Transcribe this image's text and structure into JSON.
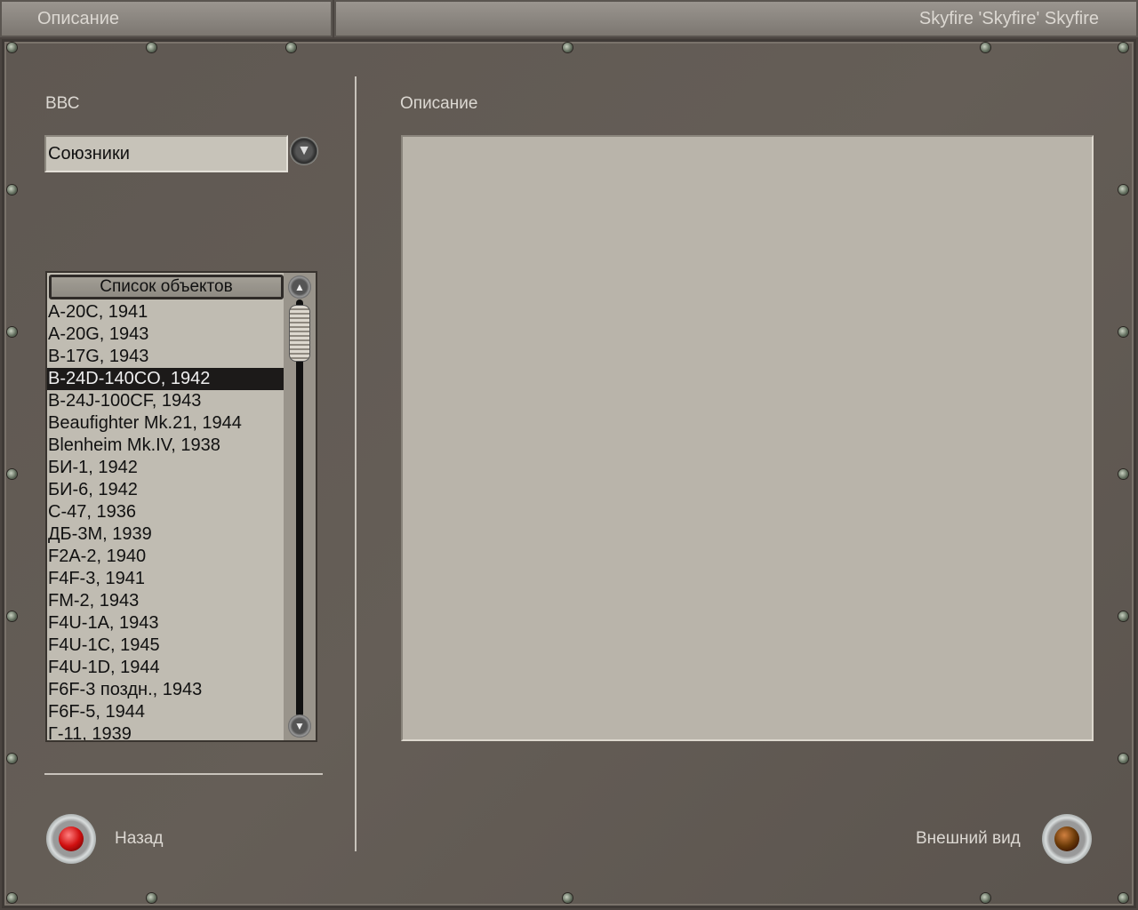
{
  "header": {
    "left_title": "Описание",
    "right_title": "Skyfire 'Skyfire' Skyfire"
  },
  "left": {
    "air_force_label": "ВВС",
    "air_force_value": "Союзники",
    "list_header": "Список объектов",
    "items": [
      "A-20C, 1941",
      "A-20G, 1943",
      "B-17G, 1943",
      "B-24D-140CO, 1942",
      "B-24J-100CF, 1943",
      "Beaufighter Mk.21, 1944",
      "Blenheim Mk.IV, 1938",
      "БИ-1, 1942",
      "БИ-6, 1942",
      "C-47, 1936",
      "ДБ-3М, 1939",
      "F2A-2, 1940",
      "F4F-3, 1941",
      "FM-2, 1943",
      "F4U-1A, 1943",
      "F4U-1C, 1945",
      "F4U-1D, 1944",
      "F6F-3 поздн., 1943",
      "F6F-5, 1944",
      "Г-11, 1939"
    ],
    "selected_index": 3
  },
  "right": {
    "description_label": "Описание",
    "description_text": ""
  },
  "footer": {
    "back_label": "Назад",
    "external_view_label": "Внешний вид"
  },
  "colors": {
    "back_lamp": "#d01010",
    "view_lamp": "#6a3a08"
  }
}
